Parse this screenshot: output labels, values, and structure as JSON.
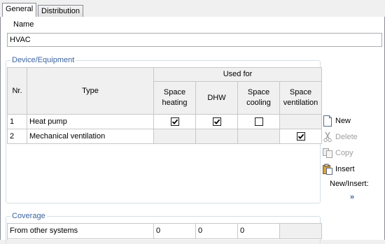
{
  "tabs": [
    {
      "label": "General",
      "active": true
    },
    {
      "label": "Distribution",
      "active": false
    }
  ],
  "name": {
    "label": "Name",
    "value": "HVAC"
  },
  "devices": {
    "title": "Device/Equipment",
    "headers": {
      "nr": "Nr.",
      "type": "Type",
      "used_for": "Used for",
      "space_heating": "Space heating",
      "dhw": "DHW",
      "space_cooling": "Space cooling",
      "space_ventilation": "Space ventilation"
    },
    "rows": [
      {
        "nr": "1",
        "type": "Heat pump",
        "space_heating": true,
        "dhw": true,
        "space_cooling": false,
        "space_ventilation": null
      },
      {
        "nr": "2",
        "type": "Mechanical ventilation",
        "space_heating": null,
        "dhw": null,
        "space_cooling": null,
        "space_ventilation": true
      }
    ]
  },
  "actions": {
    "new": "New",
    "delete": "Delete",
    "copy": "Copy",
    "insert": "Insert",
    "new_insert_label": "New/Insert:",
    "more": "»"
  },
  "coverage": {
    "title": "Coverage",
    "row_label": "From other systems",
    "values": [
      "0",
      "0",
      "0",
      ""
    ]
  },
  "colors": {
    "group_title": "#3c64a0",
    "grid_line": "#c8c8c8",
    "disabled": "#a0a0a0"
  }
}
